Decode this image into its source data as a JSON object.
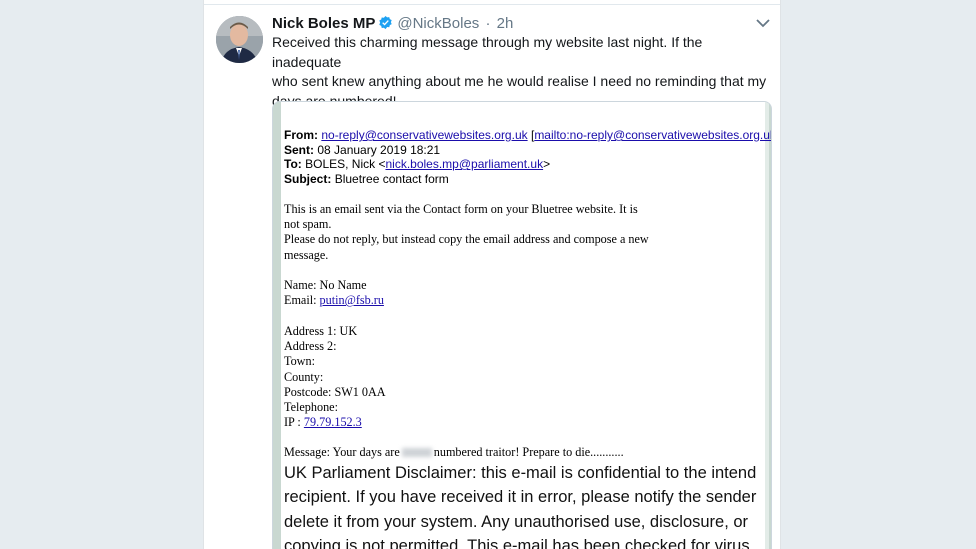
{
  "tweet": {
    "author_name": "Nick Boles MP",
    "handle": "@NickBoles",
    "separator": "·",
    "time": "2h",
    "text_lines": [
      "Received this charming message through my website last night. If the inadequate",
      "who sent knew anything  about me he would realise I need no reminding that my",
      "days are numbered!"
    ]
  },
  "email": {
    "from_label": "From:",
    "from_addr": "no-reply@conservativewebsites.org.uk",
    "from_bracket_open": "[",
    "from_mailto": "mailto:no-reply@conservativewebsites.org.uk",
    "from_bracket_close": "]",
    "sent_label": "Sent:",
    "sent_value": "08 January 2019 18:21",
    "to_label": "To:",
    "to_name": "BOLES, Nick <",
    "to_addr": "nick.boles.mp@parliament.uk",
    "to_close": ">",
    "subject_label": "Subject:",
    "subject_value": "Bluetree contact form",
    "intro_lines": [
      "This is an email sent via the Contact form on your Bluetree website. It is",
      "not spam.",
      "Please do not reply, but instead copy the email address and compose a new",
      "message."
    ],
    "name_line": "Name: No Name",
    "email_label": "Email: ",
    "email_value": "putin@fsb.ru",
    "address_lines": [
      "Address 1: UK",
      "Address 2:",
      "Town:",
      "County:",
      "Postcode: SW1 0AA",
      "Telephone:"
    ],
    "ip_label": "IP : ",
    "ip_value": "79.79.152.3",
    "message_pre": "Message: Your days are",
    "message_post": "numbered traitor! Prepare to die...........",
    "disclaimer_lines": [
      "UK Parliament Disclaimer: this e-mail is confidential to the intend",
      "recipient. If you have received it in error, please notify the sender",
      "delete it from your system. Any unauthorised use, disclosure, or",
      "copying is not permitted. This e-mail has been checked for virus"
    ]
  },
  "colors": {
    "accent": "#1da1f2",
    "link": "#1a0dab",
    "page_bg": "#e6ecf0"
  },
  "icons": {
    "verified": "verified-badge-icon",
    "menu": "chevron-down-icon"
  }
}
